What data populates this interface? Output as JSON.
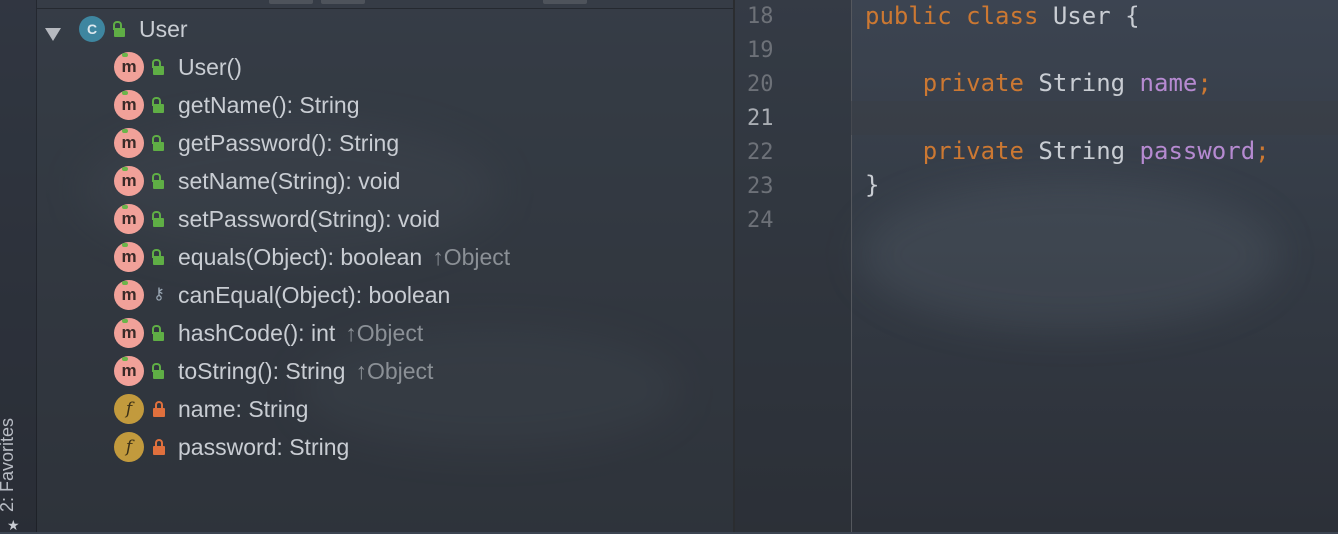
{
  "sidebar": {
    "favorites_label": "2: Favorites"
  },
  "structure": {
    "root": {
      "kind": "C",
      "label": "User"
    },
    "members": [
      {
        "kind": "m",
        "access": "public",
        "label": "User()",
        "inherited": ""
      },
      {
        "kind": "m",
        "access": "public",
        "label": "getName(): String",
        "inherited": ""
      },
      {
        "kind": "m",
        "access": "public",
        "label": "getPassword(): String",
        "inherited": ""
      },
      {
        "kind": "m",
        "access": "public",
        "label": "setName(String): void",
        "inherited": ""
      },
      {
        "kind": "m",
        "access": "public",
        "label": "setPassword(String): void",
        "inherited": ""
      },
      {
        "kind": "m",
        "access": "public",
        "label": "equals(Object): boolean",
        "inherited": "↑Object"
      },
      {
        "kind": "m",
        "access": "protected",
        "label": "canEqual(Object): boolean",
        "inherited": ""
      },
      {
        "kind": "m",
        "access": "public",
        "label": "hashCode(): int",
        "inherited": "↑Object"
      },
      {
        "kind": "m",
        "access": "public",
        "label": "toString(): String",
        "inherited": "↑Object"
      },
      {
        "kind": "f",
        "access": "private",
        "label": "name: String",
        "inherited": ""
      },
      {
        "kind": "f",
        "access": "private",
        "label": "password: String",
        "inherited": ""
      }
    ]
  },
  "editor": {
    "line_numbers": [
      "18",
      "19",
      "20",
      "21",
      "22",
      "23",
      "24"
    ],
    "current_line": "21",
    "code": {
      "l18_kw": "public class",
      "l18_rest": " User {",
      "l20_kw": "private",
      "l20_type": " String ",
      "l20_field": "name",
      "l20_semi": ";",
      "l22_kw": "private",
      "l22_type": " String ",
      "l22_field": "password",
      "l22_semi": ";",
      "l23": "}"
    }
  },
  "colors": {
    "keyword": "#cc7832",
    "field": "#b68ad1",
    "method_badge": "#f1a199",
    "field_badge": "#c29a3d",
    "class_badge": "#3e86a0",
    "public_access": "#5fae45",
    "private_access": "#e0703d"
  },
  "icons": {
    "method": "method-m-icon",
    "field": "field-f-icon",
    "class": "class-c-icon",
    "public": "unlocked-green-icon",
    "private": "lock-orange-icon",
    "protected": "key-icon",
    "favorites": "star-icon"
  }
}
